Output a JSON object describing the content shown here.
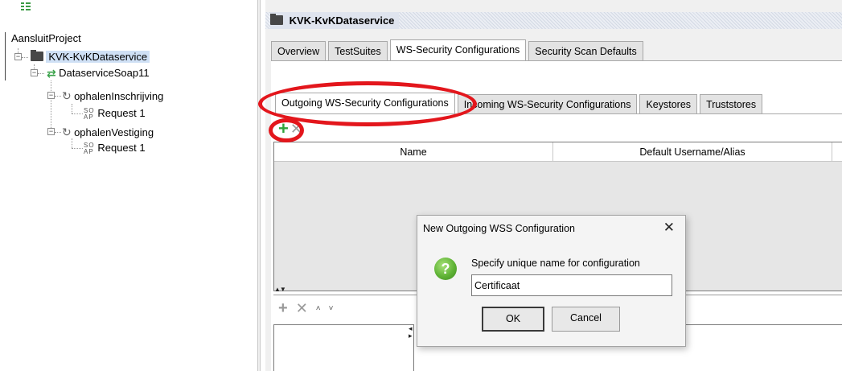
{
  "tree": {
    "project": "AansluitProject",
    "nodes": [
      {
        "label": "KVK-KvKDataservice"
      },
      {
        "label": "DataserviceSoap11"
      },
      {
        "label": "ophalenInschrijving"
      },
      {
        "label": "Request 1"
      },
      {
        "label": "ophalenVestiging"
      },
      {
        "label": "Request 1"
      }
    ],
    "soap_glyph_top": "SO",
    "soap_glyph_bottom": "AP"
  },
  "window": {
    "title": "KVK-KvKDataservice",
    "tabs": [
      "Overview",
      "TestSuites",
      "WS-Security Configurations",
      "Security Scan Defaults"
    ],
    "active_tab": "WS-Security Configurations",
    "sub_tabs": [
      "Outgoing WS-Security Configurations",
      "Incoming WS-Security Configurations",
      "Keystores",
      "Truststores"
    ],
    "active_sub_tab": "Outgoing WS-Security Configurations",
    "toolbar": {
      "add": "+",
      "remove": "✕"
    },
    "table": {
      "columns": [
        "Name",
        "Default Username/Alias"
      ]
    },
    "lower_toolbar": {
      "add": "+",
      "remove": "✕",
      "up": "˄",
      "down": "˅"
    }
  },
  "dialog": {
    "title": "New Outgoing WSS Configuration",
    "close": "✕",
    "icon": "?",
    "message": "Specify unique name for configuration",
    "input_value": "Certificaat",
    "ok_label": "OK",
    "cancel_label": "Cancel"
  },
  "colors": {
    "annotation_red": "#e3161c",
    "add_green": "#2ea33b",
    "selection_blue": "#cfe0f5"
  },
  "icons": [
    "tree-view-icon",
    "project-folder-icon",
    "interface-icon",
    "operation-icon",
    "soap-request-icon",
    "add-icon",
    "remove-icon",
    "question-icon",
    "close-icon"
  ]
}
